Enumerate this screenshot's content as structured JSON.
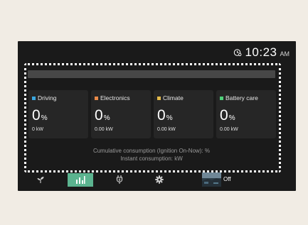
{
  "status_bar": {
    "time": "10:23",
    "ampm": "AM",
    "timezone_icon": "globe-clock-icon"
  },
  "cards": [
    {
      "label": "Driving",
      "percent": "0",
      "unit": "%",
      "power": "0 kW",
      "color": "#3aa7e0"
    },
    {
      "label": "Electronics",
      "percent": "0",
      "unit": "%",
      "power": "0.00 kW",
      "color": "#ea8a48"
    },
    {
      "label": "Climate",
      "percent": "0",
      "unit": "%",
      "power": "0.00 kW",
      "color": "#e2b94a"
    },
    {
      "label": "Battery care",
      "percent": "0",
      "unit": "%",
      "power": "0.00 kW",
      "color": "#4fcf79"
    }
  ],
  "consumption": {
    "cumulative": "Cumulative consumption (Ignition On-Now): %",
    "instant": "Instant consumption: kW"
  },
  "bottom_nav": {
    "items": [
      {
        "icon": "eco-sprout-icon",
        "active": false
      },
      {
        "icon": "bar-chart-icon",
        "active": true
      },
      {
        "icon": "ev-charge-plug-icon",
        "active": false
      },
      {
        "icon": "gear-icon",
        "active": false
      },
      {
        "icon": "camera-thumbnail",
        "active": false
      }
    ],
    "camera_state": "Off",
    "active_color": "#5bb38f"
  }
}
